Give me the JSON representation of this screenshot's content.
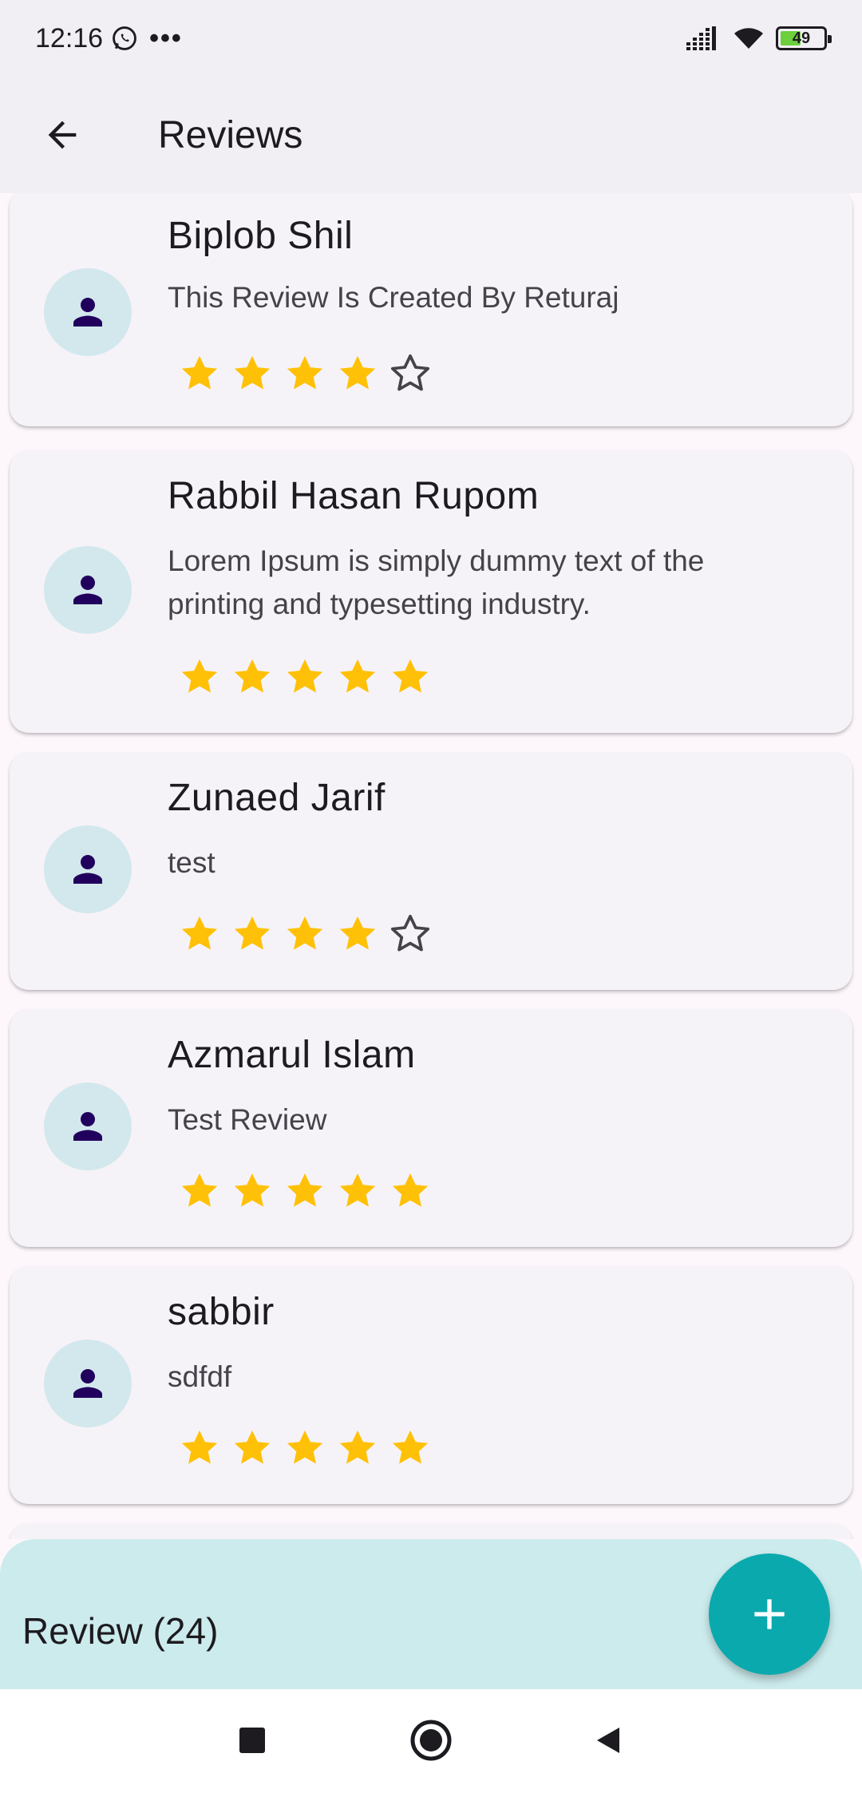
{
  "status_bar": {
    "time": "12:16",
    "dots": "•••",
    "battery": "49",
    "battery_percent": 49
  },
  "app_bar": {
    "title": "Reviews",
    "back_icon": "arrow-back-icon"
  },
  "reviews": [
    {
      "name": "Biplob Shil",
      "text": "This Review Is Created By Returaj",
      "rating": 4
    },
    {
      "name": "Rabbil Hasan Rupom",
      "text": "Lorem Ipsum is simply dummy text of the printing and typesetting industry.",
      "rating": 5
    },
    {
      "name": "Zunaed Jarif",
      "text": "test",
      "rating": 4
    },
    {
      "name": "Azmarul Islam",
      "text": "Test Review",
      "rating": 5
    },
    {
      "name": "sabbir",
      "text": "sdfdf",
      "rating": 5
    }
  ],
  "footer": {
    "review_count_label": "Review (24)",
    "fab_icon": "add-icon"
  },
  "colors": {
    "star_filled": "#FFC107",
    "star_empty_outline": "#45424a",
    "avatar_bg": "#d3e8ec",
    "avatar_icon": "#21005d",
    "fab": "#0aa9ad",
    "bottom_bar": "#ccebec"
  },
  "nav": {
    "recents_icon": "square-icon",
    "home_icon": "circle-home-icon",
    "back_icon": "triangle-back-icon"
  }
}
